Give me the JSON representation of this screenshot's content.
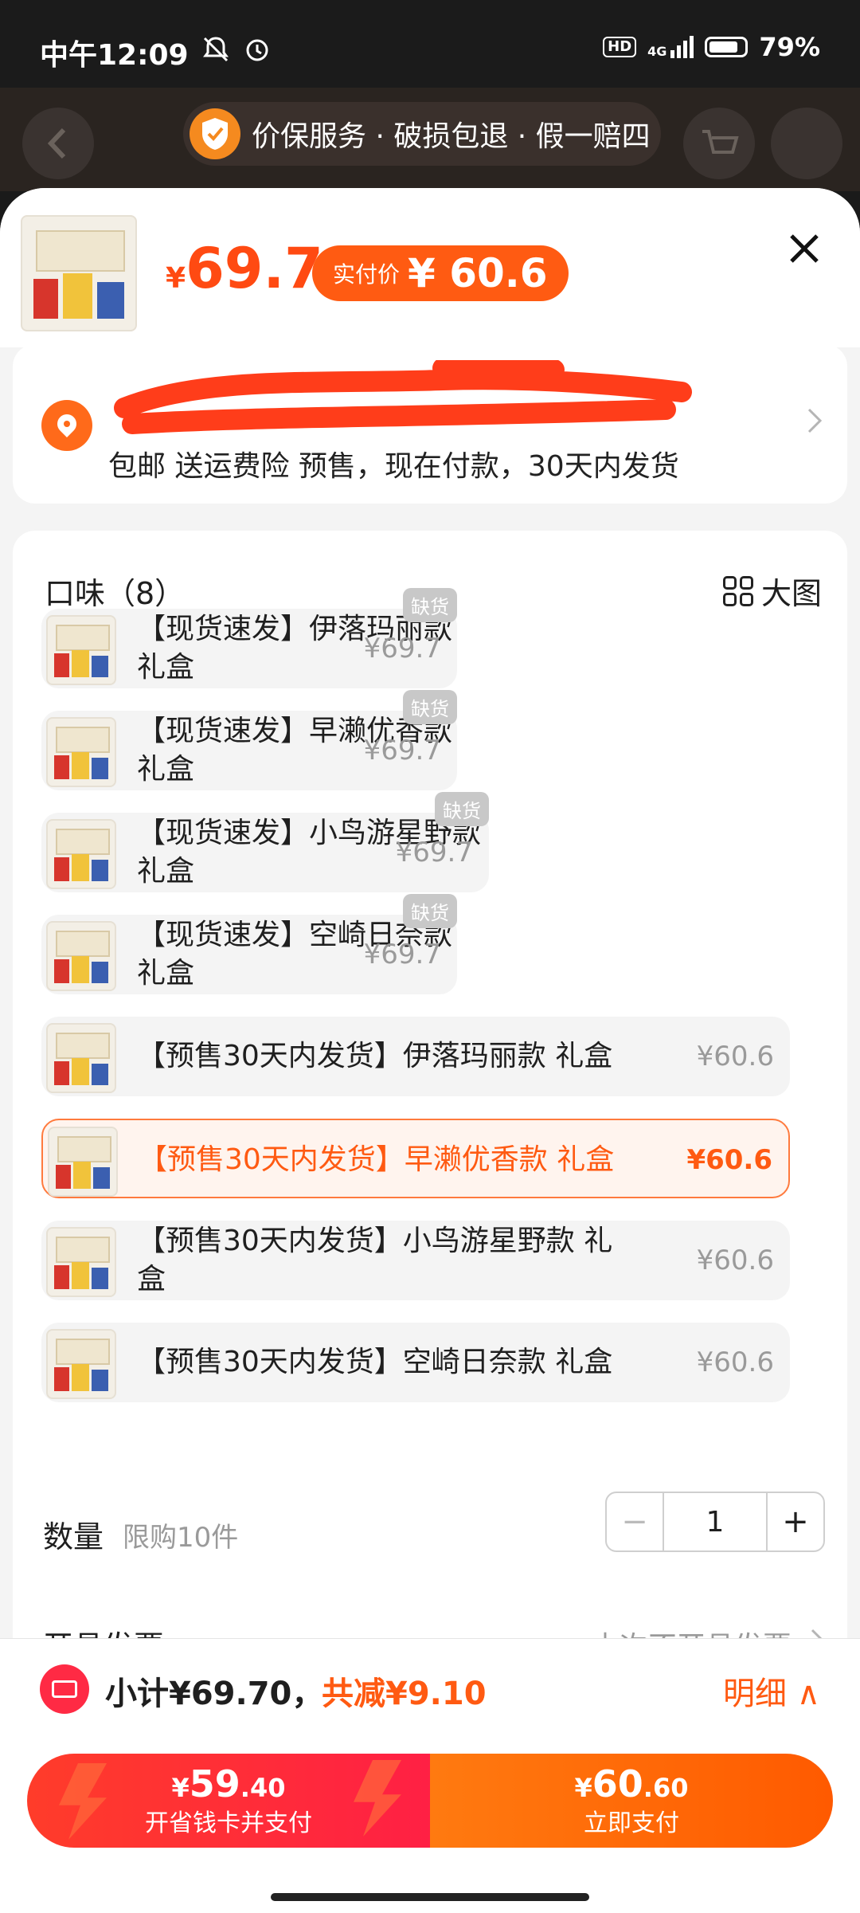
{
  "status_bar": {
    "time": "中午12:09",
    "network": "4G",
    "hd": "HD",
    "battery": "79%"
  },
  "guarantee": {
    "text": "价保服务 · 破损包退 · 假一赔四"
  },
  "product": {
    "currency": "¥",
    "price": "69.7",
    "paid_label": "实付价",
    "paid_price": "¥ 60.6"
  },
  "address": {
    "shipping_text": "包邮 送运费险 预售，现在付款，30天内发货"
  },
  "options": {
    "title": "口味（8）",
    "big_view": "大图",
    "items": [
      {
        "name": "【现货速发】伊落玛丽款 礼盒",
        "price": "¥69.7",
        "stock_badge": "缺货"
      },
      {
        "name": "【现货速发】早濑优香款 礼盒",
        "price": "¥69.7",
        "stock_badge": "缺货"
      },
      {
        "name": "【现货速发】小鸟游星野款 礼盒",
        "price": "¥69.7",
        "stock_badge": "缺货"
      },
      {
        "name": "【现货速发】空崎日奈款 礼盒",
        "price": "¥69.7",
        "stock_badge": "缺货"
      },
      {
        "name": "【预售30天内发货】伊落玛丽款 礼盒",
        "price": "¥60.6"
      },
      {
        "name": "【预售30天内发货】早濑优香款 礼盒",
        "price": "¥60.6",
        "selected": true
      },
      {
        "name": "【预售30天内发货】小鸟游星野款 礼盒",
        "price": "¥60.6"
      },
      {
        "name": "【预售30天内发货】空崎日奈款 礼盒",
        "price": "¥60.6"
      }
    ]
  },
  "quantity": {
    "label": "数量",
    "limit": "限购10件",
    "value": "1",
    "minus": "−",
    "plus": "+"
  },
  "invoice": {
    "label": "开具发票",
    "value": "本次不开具发票"
  },
  "bottom": {
    "subtotal": "小计¥69.70，",
    "discount": "共减¥9.10",
    "detail": "明细 ∧",
    "left_price_symbol": "¥",
    "left_price_int": "59",
    "left_price_dec": ".40",
    "left_label": "开省钱卡并支付",
    "right_price_symbol": "¥",
    "right_price_int": "60",
    "right_price_dec": ".60",
    "right_label": "立即支付"
  }
}
